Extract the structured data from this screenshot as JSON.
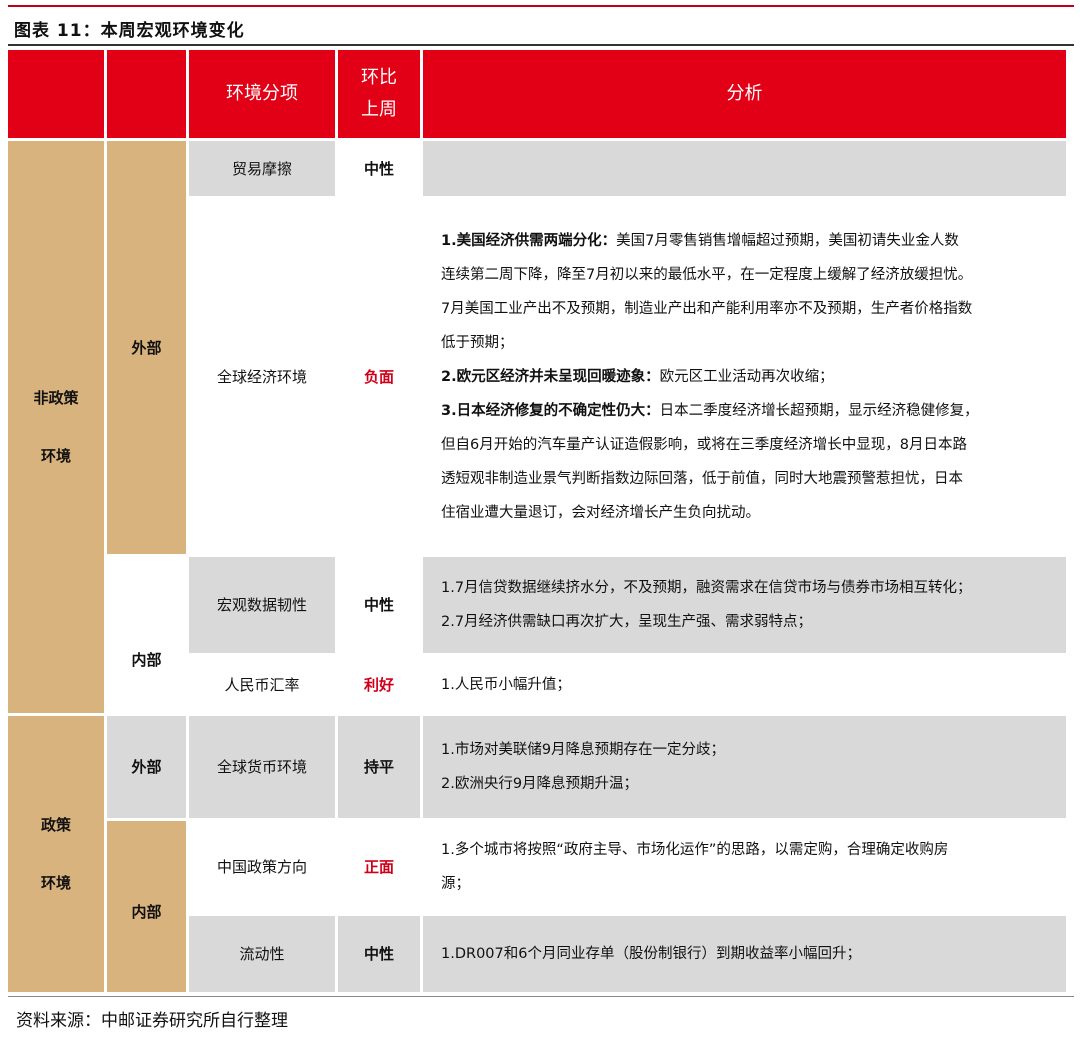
{
  "figure_title": "图表 11：本周宏观环境变化",
  "header": {
    "col3": "环境分项",
    "col4_line1": "环比",
    "col4_line2": "上周",
    "col5": "分析"
  },
  "groups": {
    "non_policy_line1": "非政策",
    "non_policy_line2": "环境",
    "policy_line1": "政策",
    "policy_line2": "环境"
  },
  "sub": {
    "external_1": "外部",
    "internal_1": "内部",
    "external_2": "外部",
    "internal_2": "内部"
  },
  "rows": [
    {
      "item": "贸易摩擦",
      "change": "中性",
      "analysis": []
    },
    {
      "item": "全球经济环境",
      "change": "负面",
      "analysis": [
        {
          "b": "1.美国经济供需两端分化：",
          "t": "美国7月零售销售增幅超过预期，美国初请失业金人数"
        },
        {
          "b": "",
          "t": "连续第二周下降，降至7月初以来的最低水平，在一定程度上缓解了经济放缓担忧。"
        },
        {
          "b": "",
          "t": "7月美国工业产出不及预期，制造业产出和产能利用率亦不及预期，生产者价格指数"
        },
        {
          "b": "",
          "t": "低于预期；"
        },
        {
          "b": "2.欧元区经济并未呈现回暖迹象：",
          "t": "欧元区工业活动再次收缩；"
        },
        {
          "b": "3.日本经济修复的不确定性仍大：",
          "t": "日本二季度经济增长超预期，显示经济稳健修复，"
        },
        {
          "b": "",
          "t": "但自6月开始的汽车量产认证造假影响，或将在三季度经济增长中显现，8月日本路"
        },
        {
          "b": "",
          "t": "透短观非制造业景气判断指数边际回落，低于前值，同时大地震预警惹担忧，日本"
        },
        {
          "b": "",
          "t": "住宿业遭大量退订，会对经济增长产生负向扰动。"
        }
      ]
    },
    {
      "item": "宏观数据韧性",
      "change": "中性",
      "analysis": [
        {
          "b": "",
          "t": "1.7月信贷数据继续挤水分，不及预期，融资需求在信贷市场与债券市场相互转化；"
        },
        {
          "b": "",
          "t": "2.7月经济供需缺口再次扩大，呈现生产强、需求弱特点；"
        }
      ]
    },
    {
      "item": "人民币汇率",
      "change": "利好",
      "analysis": [
        {
          "b": "",
          "t": "1.人民币小幅升值；"
        }
      ]
    },
    {
      "item": "全球货币环境",
      "change": "持平",
      "analysis": [
        {
          "b": "",
          "t": "1.市场对美联储9月降息预期存在一定分歧；"
        },
        {
          "b": "",
          "t": "2.欧洲央行9月降息预期升温；"
        }
      ]
    },
    {
      "item": "中国政策方向",
      "change": "正面",
      "analysis": [
        {
          "b": "",
          "t": "1.多个城市将按照“政府主导、市场化运作”的思路，以需定购，合理确定收购房"
        },
        {
          "b": "",
          "t": "源；"
        }
      ]
    },
    {
      "item": "流动性",
      "change": "中性",
      "analysis": [
        {
          "b": "",
          "t": "1.DR007和6个月同业存单（股份制银行）到期收益率小幅回升；"
        }
      ]
    }
  ],
  "source": "资料来源：中邮证券研究所自行整理",
  "colors": {
    "header_red": "#e10015",
    "group_tan": "#d9b37e",
    "row_gray": "#d9d9d9",
    "text_red": "#d0001a"
  }
}
